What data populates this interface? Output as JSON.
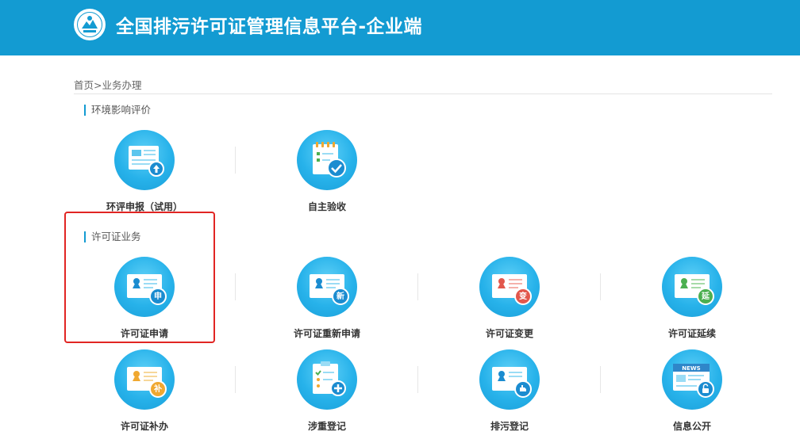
{
  "header": {
    "title": "全国排污许可证管理信息平台-企业端"
  },
  "breadcrumb": {
    "home": "首页",
    "separator": ">",
    "current": "业务办理"
  },
  "sections": {
    "eia": {
      "title": "环境影响评价"
    },
    "permit": {
      "title": "许可证业务"
    }
  },
  "items": {
    "eia_apply": "环评申报（试用）",
    "self_accept": "自主验收",
    "permit_apply": "许可证申请",
    "permit_reapply": "许可证重新申请",
    "permit_change": "许可证变更",
    "permit_extend": "许可证延续",
    "permit_supplement": "许可证补办",
    "heavy_register": "涉重登记",
    "discharge_register": "排污登记",
    "info_public": "信息公开"
  },
  "badges": {
    "apply": "申",
    "new": "新",
    "change": "变",
    "extend": "延",
    "supplement": "补",
    "news": "NEWS"
  },
  "colors": {
    "header": "#139bd2",
    "highlight": "#e12523",
    "badge_apply": "#1b8cd0",
    "badge_change": "#e2574c",
    "badge_extend": "#4caf50",
    "badge_supplement": "#f0a830"
  }
}
